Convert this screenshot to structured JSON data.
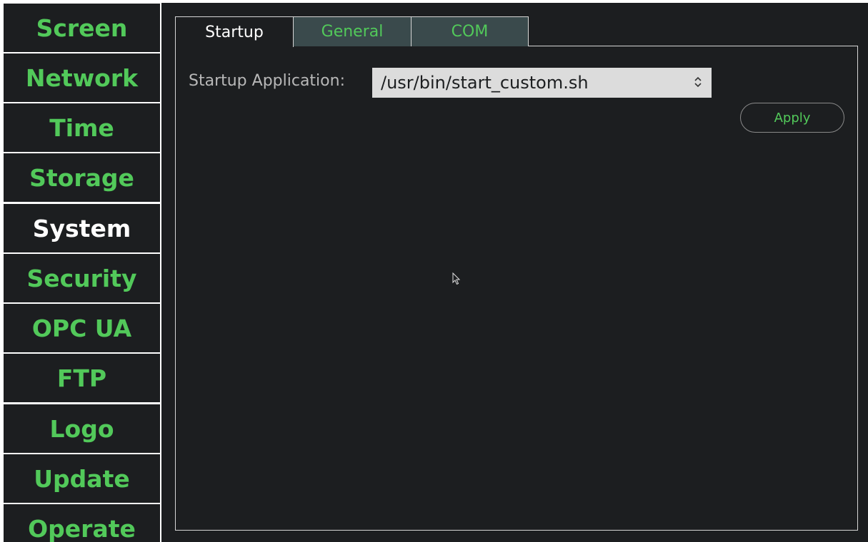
{
  "sidebar": {
    "items": [
      {
        "label": "Screen",
        "active": false
      },
      {
        "label": "Network",
        "active": false
      },
      {
        "label": "Time",
        "active": false
      },
      {
        "label": "Storage",
        "active": false
      },
      {
        "label": "System",
        "active": true
      },
      {
        "label": "Security",
        "active": false
      },
      {
        "label": "OPC UA",
        "active": false
      },
      {
        "label": "FTP",
        "active": false
      },
      {
        "label": "Logo",
        "active": false
      },
      {
        "label": "Update",
        "active": false
      },
      {
        "label": "Operate",
        "active": false
      }
    ]
  },
  "tabs": [
    {
      "label": "Startup",
      "active": true
    },
    {
      "label": "General",
      "active": false
    },
    {
      "label": "COM",
      "active": false
    }
  ],
  "startup": {
    "label": "Startup Application:",
    "selected_value": "/usr/bin/start_custom.sh",
    "apply_label": "Apply"
  },
  "colors": {
    "background": "#1c1e20",
    "accent_green": "#52c95a",
    "inactive_tab": "#3a4a4c",
    "select_bg": "#dcdcdc"
  },
  "icons": {
    "select_arrow": "chevron-up-down-icon",
    "cursor": "mouse-pointer-icon"
  }
}
